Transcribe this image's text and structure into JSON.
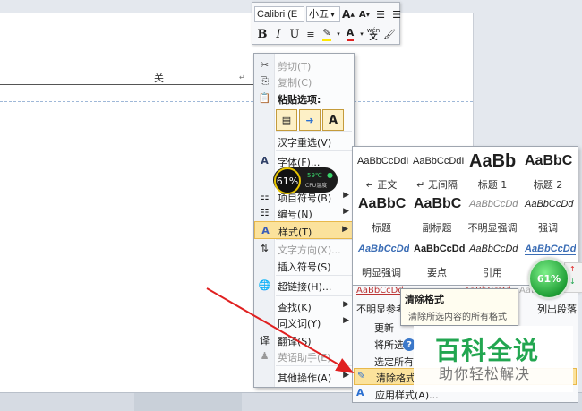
{
  "document": {
    "header_text": "关",
    "paragraph_mark": "↵"
  },
  "mini_toolbar": {
    "font_name": "Calibri (E",
    "font_size": "小五",
    "grow_font": "A",
    "shrink_font": "A",
    "bold": "B",
    "italic": "I",
    "underline": "U",
    "font_color": "A",
    "phonetic": "wén"
  },
  "context_menu": {
    "items": {
      "cut": "剪切(T)",
      "copy": "复制(C)",
      "paste_options": "粘贴选项:",
      "paste_keep_text": "A",
      "reconvert": "汉字重选(V)",
      "font": "字体(F)...",
      "bullets": "项目符号(B)",
      "numbering": "编号(N)",
      "styles": "样式(T)",
      "text_direction": "文字方向(X)...",
      "insert_symbol": "插入符号(S)",
      "hyperlink": "超链接(H)...",
      "lookup": "查找(K)",
      "synonyms": "同义词(Y)",
      "translate": "翻译(S)",
      "english_assistant": "英语助手(E)",
      "other_actions": "其他操作(A)"
    }
  },
  "styles_gallery": {
    "cells": [
      {
        "preview": "AaBbCcDdI",
        "name": "↵ 正文"
      },
      {
        "preview": "AaBbCcDdI",
        "name": "↵ 无间隔"
      },
      {
        "preview": "AaBb",
        "name": "标题 1"
      },
      {
        "preview": "AaBbC",
        "name": "标题 2"
      },
      {
        "preview": "AaBbC",
        "name": "标题"
      },
      {
        "preview": "AaBbC",
        "name": "副标题"
      },
      {
        "preview": "AaBbCcDd",
        "name": "不明显强调"
      },
      {
        "preview": "AaBbCcDd",
        "name": "强调"
      },
      {
        "preview": "AaBbCcDd",
        "name": "明显强调"
      },
      {
        "preview": "AaBbCcDd",
        "name": "要点"
      },
      {
        "preview": "AaBbCcDd",
        "name": "引用"
      },
      {
        "preview": "AaBbCcDd",
        "name": ""
      }
    ],
    "row4_previews": [
      "AaBbCcDd",
      "AaBbCcDd",
      "AaBbCcDd"
    ],
    "row4_partial_name": "不明显参考",
    "list_paragraph": "列出段落"
  },
  "style_menu": {
    "items": [
      "更新",
      "将所选",
      "选定所有",
      "清除格式",
      "应用样式(A)..."
    ]
  },
  "tooltip": {
    "title": "清除格式",
    "desc": "清除所选内容的所有格式"
  },
  "overlays": {
    "cpu_percent": "61%",
    "cpu_temp": "59℃",
    "cpu_label": "CPU温度",
    "ball_percent": "61%",
    "watermark_title": "百科全说",
    "watermark_subtitle": "助你轻松解决"
  },
  "colors": {
    "highlight": "#fbe29c",
    "watermark_green": "#22a650",
    "arrow_red": "#e02020"
  }
}
